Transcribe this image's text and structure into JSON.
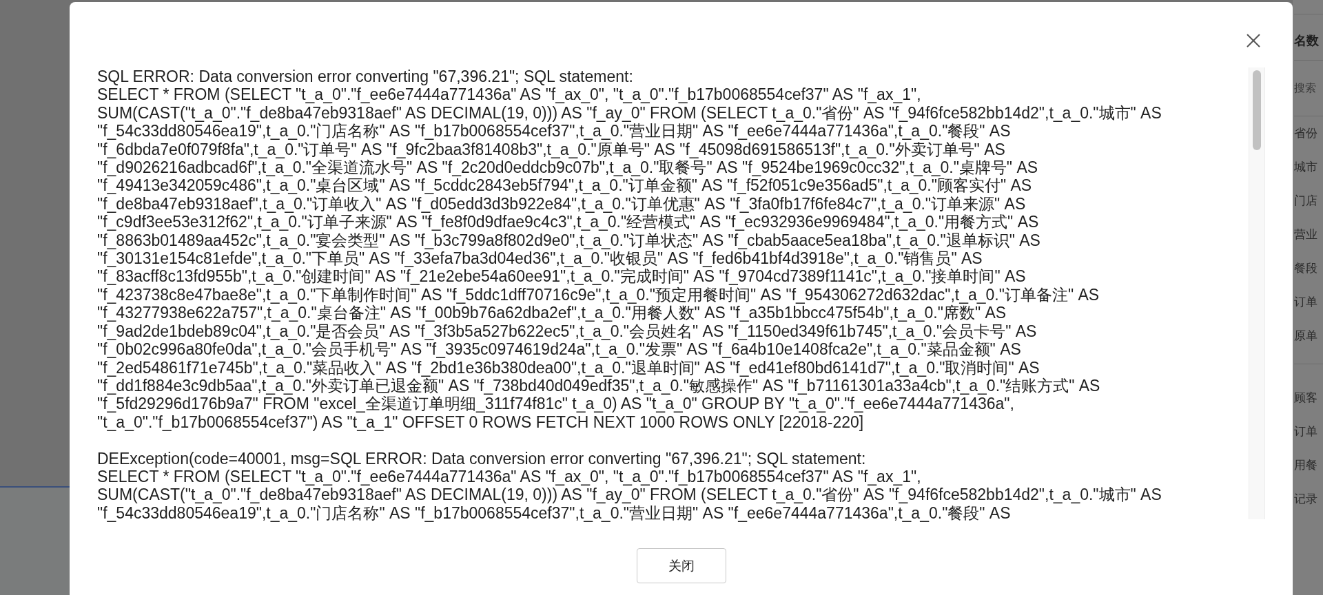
{
  "background_panel": {
    "title": "名数",
    "search": {
      "placeholder": "搜索"
    },
    "fields_top": [
      "省份",
      "城市",
      "门店",
      "营业",
      "餐段",
      "订单",
      "原单"
    ],
    "fields_bottom": [
      "顾客",
      "订单",
      "用餐",
      "记录"
    ]
  },
  "dialog": {
    "messages": [
      {
        "lines": [
          "SQL ERROR: Data conversion error converting \"67,396.21\"; SQL statement:",
          "SELECT * FROM (SELECT \"t_a_0\".\"f_ee6e7444a771436a\" AS \"f_ax_0\", \"t_a_0\".\"f_b17b0068554cef37\" AS \"f_ax_1\",",
          "SUM(CAST(\"t_a_0\".\"f_de8ba47eb9318aef\" AS DECIMAL(19, 0))) AS \"f_ay_0\" FROM (SELECT t_a_0.\"省份\" AS \"f_94f6fce582bb14d2\",t_a_0.\"城市\" AS",
          "\"f_54c33dd80546ea19\",t_a_0.\"门店名称\" AS \"f_b17b0068554cef37\",t_a_0.\"营业日期\" AS \"f_ee6e7444a771436a\",t_a_0.\"餐段\" AS",
          "\"f_6dbda7e0f079f8fa\",t_a_0.\"订单号\" AS \"f_9fc2baa3f81408b3\",t_a_0.\"原单号\" AS \"f_45098d691586513f\",t_a_0.\"外卖订单号\" AS",
          "\"f_d9026216adbcad6f\",t_a_0.\"全渠道流水号\" AS \"f_2c20d0eddcb9c07b\",t_a_0.\"取餐号\" AS \"f_9524be1969c0cc32\",t_a_0.\"桌牌号\" AS",
          "\"f_49413e342059c486\",t_a_0.\"桌台区域\" AS \"f_5cddc2843eb5f794\",t_a_0.\"订单金额\" AS \"f_f52f051c9e356ad5\",t_a_0.\"顾客实付\" AS",
          "\"f_de8ba47eb9318aef\",t_a_0.\"订单收入\" AS \"f_d05edd3d3b922e84\",t_a_0.\"订单优惠\" AS \"f_3fa0fb17f6fe84c7\",t_a_0.\"订单来源\" AS",
          "\"f_c9df3ee53e312f62\",t_a_0.\"订单子来源\" AS \"f_fe8f0d9dfae9c4c3\",t_a_0.\"经营模式\" AS \"f_ec932936e9969484\",t_a_0.\"用餐方式\" AS",
          "\"f_8863b01489aa452c\",t_a_0.\"宴会类型\" AS \"f_b3c799a8f802d9e0\",t_a_0.\"订单状态\" AS \"f_cbab5aace5ea18ba\",t_a_0.\"退单标识\" AS",
          "\"f_30131e154c81efde\",t_a_0.\"下单员\" AS \"f_33efa7ba3d04ed36\",t_a_0.\"收银员\" AS \"f_fed6b41bf4d3918e\",t_a_0.\"销售员\" AS",
          "\"f_83acff8c13fd955b\",t_a_0.\"创建时间\" AS \"f_21e2ebe54a60ee91\",t_a_0.\"完成时间\" AS \"f_9704cd7389f1141c\",t_a_0.\"接单时间\" AS",
          "\"f_423738c8e47bae8e\",t_a_0.\"下单制作时间\" AS \"f_5ddc1dff70716c9e\",t_a_0.\"预定用餐时间\" AS \"f_954306272d632dac\",t_a_0.\"订单备注\" AS",
          "\"f_43277938e622a757\",t_a_0.\"桌台备注\" AS \"f_00b9b76a62dba2ef\",t_a_0.\"用餐人数\" AS \"f_a35b1bbcc475f54b\",t_a_0.\"席数\" AS",
          "\"f_9ad2de1bdeb89c04\",t_a_0.\"是否会员\" AS \"f_3f3b5a527b622ec5\",t_a_0.\"会员姓名\" AS \"f_1150ed349f61b745\",t_a_0.\"会员卡号\" AS",
          "\"f_0b02c996a80fe0da\",t_a_0.\"会员手机号\" AS \"f_3935c0974619d24a\",t_a_0.\"发票\" AS \"f_6a4b10e1408fca2e\",t_a_0.\"菜品金额\" AS",
          "\"f_2ed54861f71e745b\",t_a_0.\"菜品收入\" AS \"f_2bd1e36b380dea00\",t_a_0.\"退单时间\" AS \"f_ed41ef80bd6141d7\",t_a_0.\"取消时间\" AS",
          "\"f_dd1f884e3c9db5aa\",t_a_0.\"外卖订单已退金额\" AS \"f_738bd40d049edf35\",t_a_0.\"敏感操作\" AS \"f_b71161301a33a4cb\",t_a_0.\"结账方式\" AS",
          "\"f_5fd29296d176b9a7\" FROM \"excel_全渠道订单明细_311f74f81c\" t_a_0) AS \"t_a_0\" GROUP BY \"t_a_0\".\"f_ee6e7444a771436a\",",
          "\"t_a_0\".\"f_b17b0068554cef37\") AS \"t_a_1\" OFFSET 0 ROWS FETCH NEXT 1000 ROWS ONLY [22018-220]"
        ]
      },
      {
        "lines": [
          "DEException(code=40001, msg=SQL ERROR: Data conversion error converting \"67,396.21\"; SQL statement:",
          "SELECT * FROM (SELECT \"t_a_0\".\"f_ee6e7444a771436a\" AS \"f_ax_0\", \"t_a_0\".\"f_b17b0068554cef37\" AS \"f_ax_1\",",
          "SUM(CAST(\"t_a_0\".\"f_de8ba47eb9318aef\" AS DECIMAL(19, 0))) AS \"f_ay_0\" FROM (SELECT t_a_0.\"省份\" AS \"f_94f6fce582bb14d2\",t_a_0.\"城市\" AS",
          "\"f_54c33dd80546ea19\",t_a_0.\"门店名称\" AS \"f_b17b0068554cef37\",t_a_0.\"营业日期\" AS \"f_ee6e7444a771436a\",t_a_0.\"餐段\" AS"
        ]
      }
    ],
    "buttons": [
      "关闭"
    ]
  }
}
